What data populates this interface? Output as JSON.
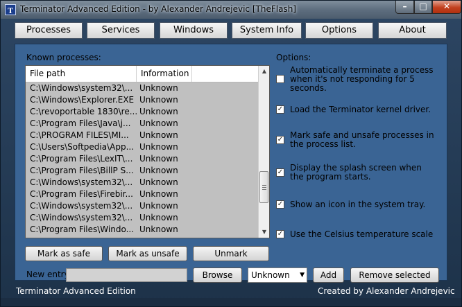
{
  "window": {
    "title": "Terminator Advanced Edition - by Alexander Andrejevic [TheFlash]",
    "icon_letter": "T",
    "controls": {
      "minimize": "–",
      "maximize": "□",
      "close": "✕"
    }
  },
  "tabs": [
    {
      "label": "Processes"
    },
    {
      "label": "Services"
    },
    {
      "label": "Windows"
    },
    {
      "label": "System Info"
    },
    {
      "label": "Options"
    },
    {
      "label": "About"
    }
  ],
  "processes": {
    "label": "Known processes:",
    "columns": [
      "File path",
      "Information"
    ],
    "rows": [
      [
        "C:\\Windows\\system32\\...",
        "Unknown"
      ],
      [
        "C:\\Windows\\Explorer.EXE",
        "Unknown"
      ],
      [
        "C:\\revoportable 1830\\re...",
        "Unknown"
      ],
      [
        "C:\\Program Files\\Java\\j...",
        "Unknown"
      ],
      [
        "C:\\PROGRAM FILES\\MI...",
        "Unknown"
      ],
      [
        "C:\\Users\\Softpedia\\App...",
        "Unknown"
      ],
      [
        "C:\\Program Files\\LexIT\\...",
        "Unknown"
      ],
      [
        "C:\\Program Files\\BillP S...",
        "Unknown"
      ],
      [
        "C:\\Windows\\system32\\...",
        "Unknown"
      ],
      [
        "C:\\Program Files\\Firebir...",
        "Unknown"
      ],
      [
        "C:\\Windows\\system32\\...",
        "Unknown"
      ],
      [
        "C:\\Windows\\system32\\...",
        "Unknown"
      ],
      [
        "C:\\Program Files\\Windo...",
        "Unknown"
      ]
    ],
    "buttons": {
      "mark_safe": "Mark as safe",
      "mark_unsafe": "Mark as unsafe",
      "unmark": "Unmark"
    }
  },
  "options": {
    "label": "Options:",
    "items": [
      {
        "text": "Automatically terminate a process when it's not responding for 5 seconds.",
        "checked": false
      },
      {
        "text": "Load the Terminator kernel driver.",
        "checked": true
      },
      {
        "text": "Mark safe and unsafe processes in the process list.",
        "checked": true
      },
      {
        "text": "Display the splash screen when the program starts.",
        "checked": true
      },
      {
        "text": "Show an icon in the system tray.",
        "checked": true
      },
      {
        "text": "Use the Celsius temperature scale",
        "checked": true
      }
    ]
  },
  "entry": {
    "label": "New entry:",
    "value": "",
    "browse_label": "Browse",
    "type_selected": "Unknown",
    "add_label": "Add",
    "remove_label": "Remove selected"
  },
  "footer": {
    "left": "Terminator Advanced Edition",
    "right": "Created by Alexander Andrejevic"
  }
}
